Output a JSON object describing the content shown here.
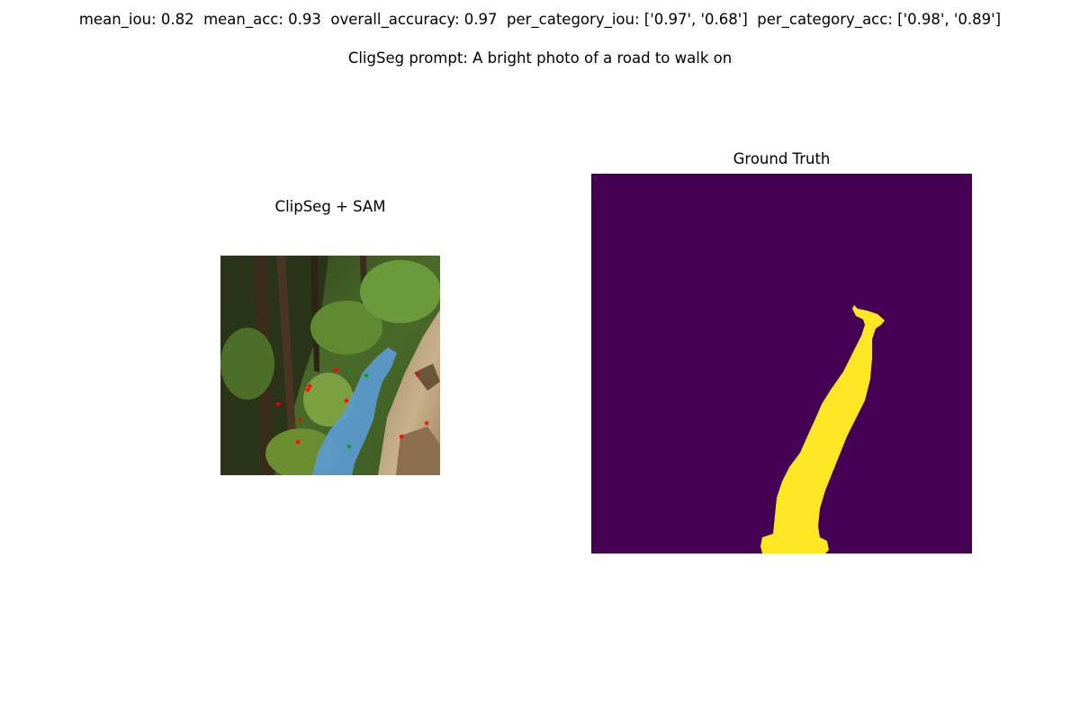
{
  "header": {
    "metrics_text": "mean_iou: 0.82  mean_acc: 0.93  overall_accuracy: 0.97  per_category_iou: ['0.97', '0.68']  per_category_acc: ['0.98', '0.89']",
    "prompt_text": "CligSeg prompt: A bright photo of a road to walk on"
  },
  "panels": {
    "left_title": "ClipSeg + SAM",
    "right_title": "Ground Truth"
  },
  "colors": {
    "mask_background": "#440154",
    "mask_foreground": "#fde725",
    "overlay_mask": "#5b9bd5",
    "negative_point": "#ff0000",
    "positive_point": "#00a000"
  },
  "metrics": {
    "mean_iou": 0.82,
    "mean_acc": 0.93,
    "overall_accuracy": 0.97,
    "per_category_iou": [
      "0.97",
      "0.68"
    ],
    "per_category_acc": [
      "0.98",
      "0.89"
    ]
  }
}
